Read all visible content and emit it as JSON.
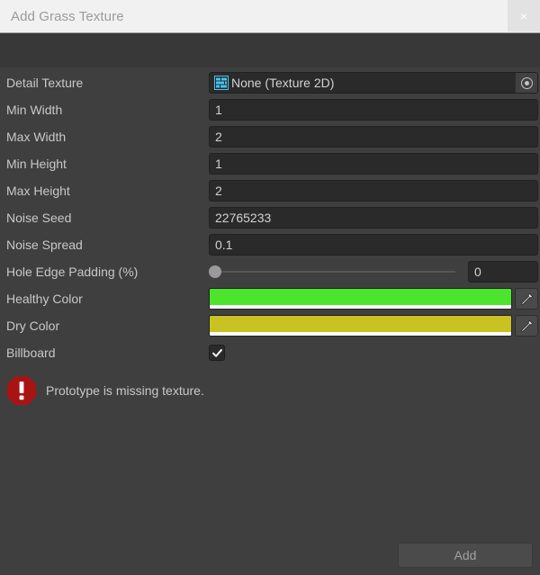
{
  "window": {
    "title": "Add Grass Texture",
    "close_label": "×",
    "close_icon": "close-icon"
  },
  "form": {
    "detail_texture": {
      "label": "Detail Texture",
      "value": "None (Texture 2D)",
      "icon": "texture-2d-icon",
      "picker_icon": "object-picker-icon"
    },
    "min_width": {
      "label": "Min Width",
      "value": "1"
    },
    "max_width": {
      "label": "Max Width",
      "value": "2"
    },
    "min_height": {
      "label": "Min Height",
      "value": "1"
    },
    "max_height": {
      "label": "Max Height",
      "value": "2"
    },
    "noise_seed": {
      "label": "Noise Seed",
      "value": "22765233"
    },
    "noise_spread": {
      "label": "Noise Spread",
      "value": "0.1"
    },
    "hole_edge_padding": {
      "label": "Hole Edge Padding (%)",
      "value": "0",
      "slider_percent": 0,
      "min": 0,
      "max": 100
    },
    "healthy_color": {
      "label": "Healthy Color",
      "color": "#4ce42c",
      "alpha_color": "#ffffff",
      "eyedropper_icon": "eyedropper-icon"
    },
    "dry_color": {
      "label": "Dry Color",
      "color": "#c9c222",
      "alpha_color": "#ffffff",
      "eyedropper_icon": "eyedropper-icon"
    },
    "billboard": {
      "label": "Billboard",
      "checked": true,
      "check_icon": "checkmark-icon"
    }
  },
  "message": {
    "text": "Prototype is missing texture.",
    "icon": "error-icon",
    "icon_color": "#a81414"
  },
  "footer": {
    "add_label": "Add"
  }
}
